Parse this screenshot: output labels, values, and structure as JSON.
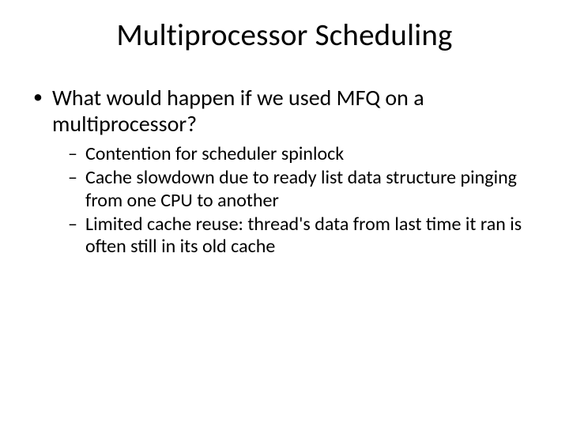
{
  "title": "Multiprocessor Scheduling",
  "bullets": [
    {
      "text": "What would happen if we used MFQ on a multiprocessor?",
      "sub": [
        "Contention for scheduler spinlock",
        "Cache slowdown due to ready list data structure pinging from one CPU to another",
        "Limited cache reuse: thread's data from last time it ran is often still in its old cache"
      ]
    }
  ]
}
